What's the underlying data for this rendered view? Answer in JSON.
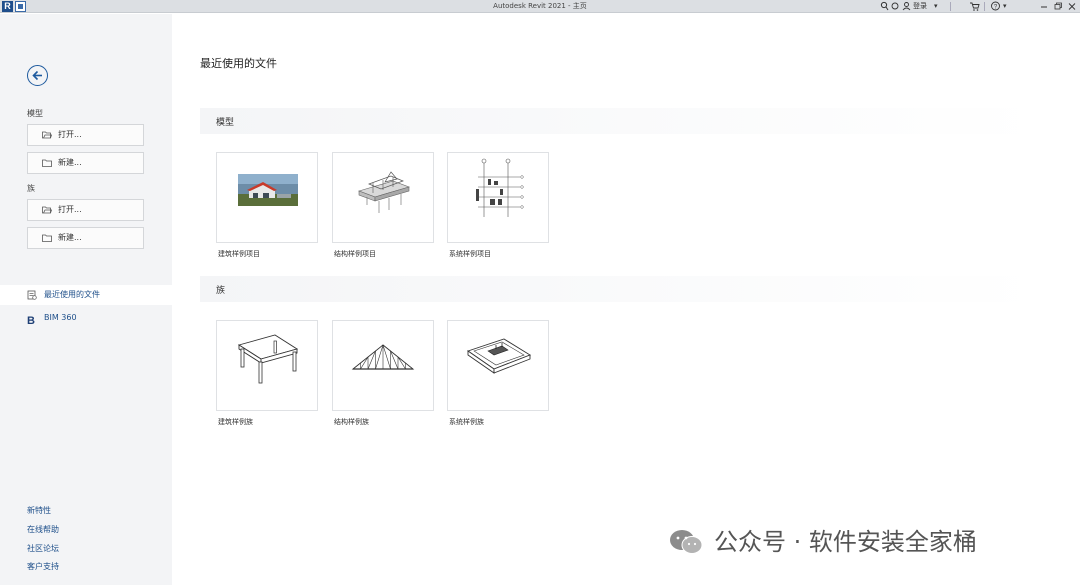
{
  "titlebar": {
    "app_logo": "R",
    "title": "Autodesk Revit 2021 - 主页",
    "sign_in": "登录",
    "help": "?"
  },
  "sidebar": {
    "model_label": "模型",
    "model_open": "打开...",
    "model_new": "新建...",
    "family_label": "族",
    "family_open": "打开...",
    "family_new": "新建...",
    "nav": [
      {
        "label": "最近使用的文件",
        "active": true
      },
      {
        "label": "BIM 360",
        "active": false
      }
    ],
    "links": [
      "新特性",
      "在线帮助",
      "社区论坛",
      "客户支持"
    ]
  },
  "main": {
    "title": "最近使用的文件",
    "models_label": "模型",
    "models": [
      {
        "name": "建筑样例项目"
      },
      {
        "name": "结构样例项目"
      },
      {
        "name": "系统样例项目"
      }
    ],
    "families_label": "族",
    "families": [
      {
        "name": "建筑样例族"
      },
      {
        "name": "结构样例族"
      },
      {
        "name": "系统样例族"
      }
    ]
  },
  "watermark": {
    "text": "公众号 · 软件安装全家桶"
  },
  "colors": {
    "accent": "#1e5a9e",
    "sidebar_bg": "#f3f4f6",
    "titlebar_bg": "#dcdfe3"
  },
  "icons": [
    "back-arrow-icon",
    "open-folder-icon",
    "new-file-icon",
    "recent-files-icon",
    "bim360-icon",
    "search-icon",
    "user-icon",
    "cart-icon",
    "help-icon",
    "minimize-icon",
    "restore-icon",
    "close-icon",
    "wechat-icon"
  ]
}
